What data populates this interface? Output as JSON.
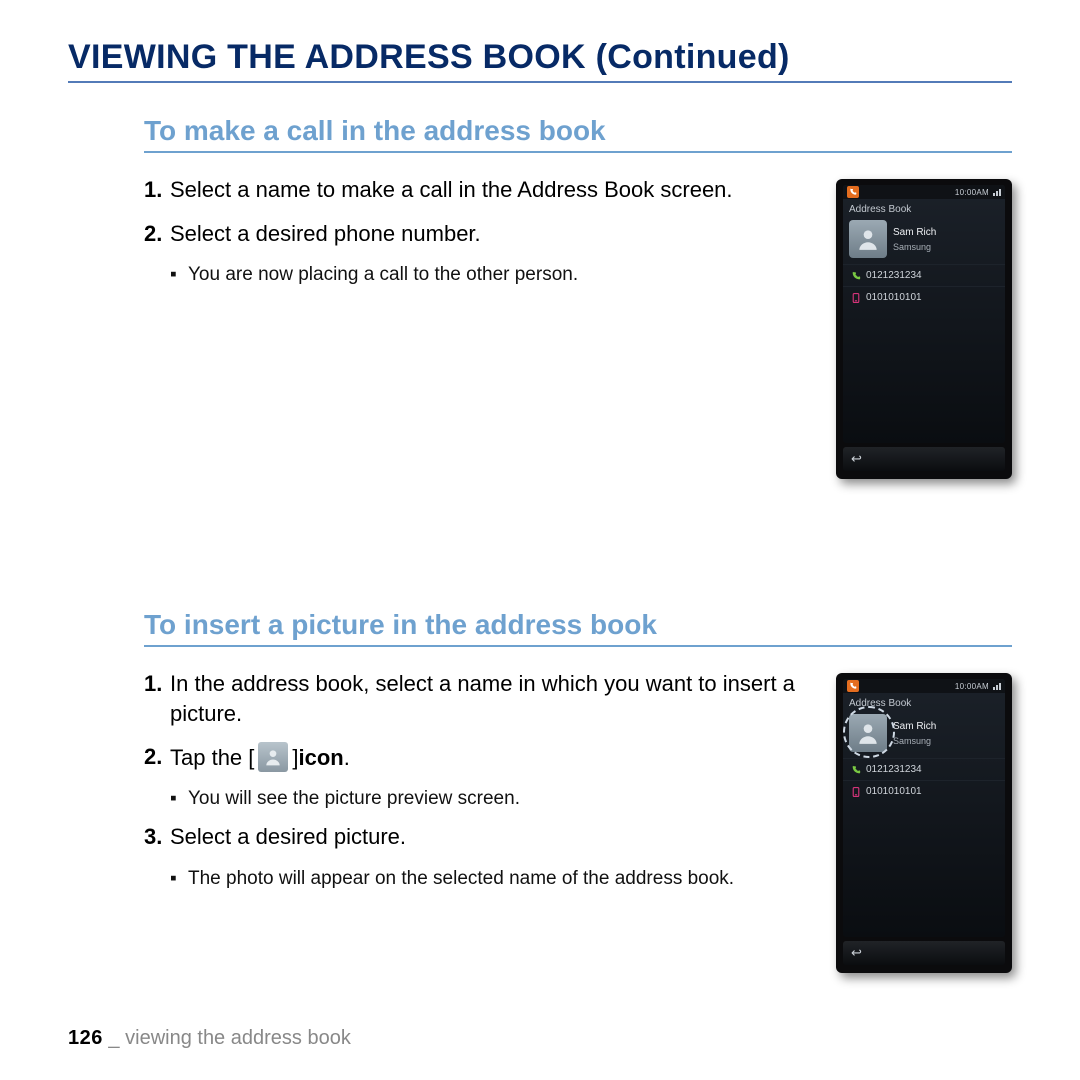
{
  "header": {
    "title": "VIEWING THE ADDRESS BOOK (Continued)"
  },
  "section1": {
    "heading": "To make a call in the address book",
    "steps": {
      "s1_num": "1.",
      "s1_text": "Select a name to make a call in the Address Book screen.",
      "s2_num": "2.",
      "s2_text": "Select a desired phone number.",
      "s2_sub1": "You are now placing a call to the other person."
    }
  },
  "section2": {
    "heading": "To insert a picture in the address book",
    "steps": {
      "s1_num": "1.",
      "s1_text": "In the address book, select a name in which you want to insert a picture.",
      "s2_num": "2.",
      "s2_text_a": "Tap the [",
      "s2_text_b": "] ",
      "s2_text_c": "icon",
      "s2_text_d": ".",
      "s2_sub1": "You will see the picture preview screen.",
      "s3_num": "3.",
      "s3_text": "Select a desired picture.",
      "s3_sub1": "The photo will appear on the selected name of the address book."
    }
  },
  "phone": {
    "time": "10:00AM",
    "app_title": "Address Book",
    "contact_name": "Sam Rich",
    "contact_sub": "Samsung",
    "number1": "0121231234",
    "number2": "0101010101"
  },
  "footer": {
    "page_num": "126",
    "separator": " _ ",
    "text": "viewing the address book"
  }
}
